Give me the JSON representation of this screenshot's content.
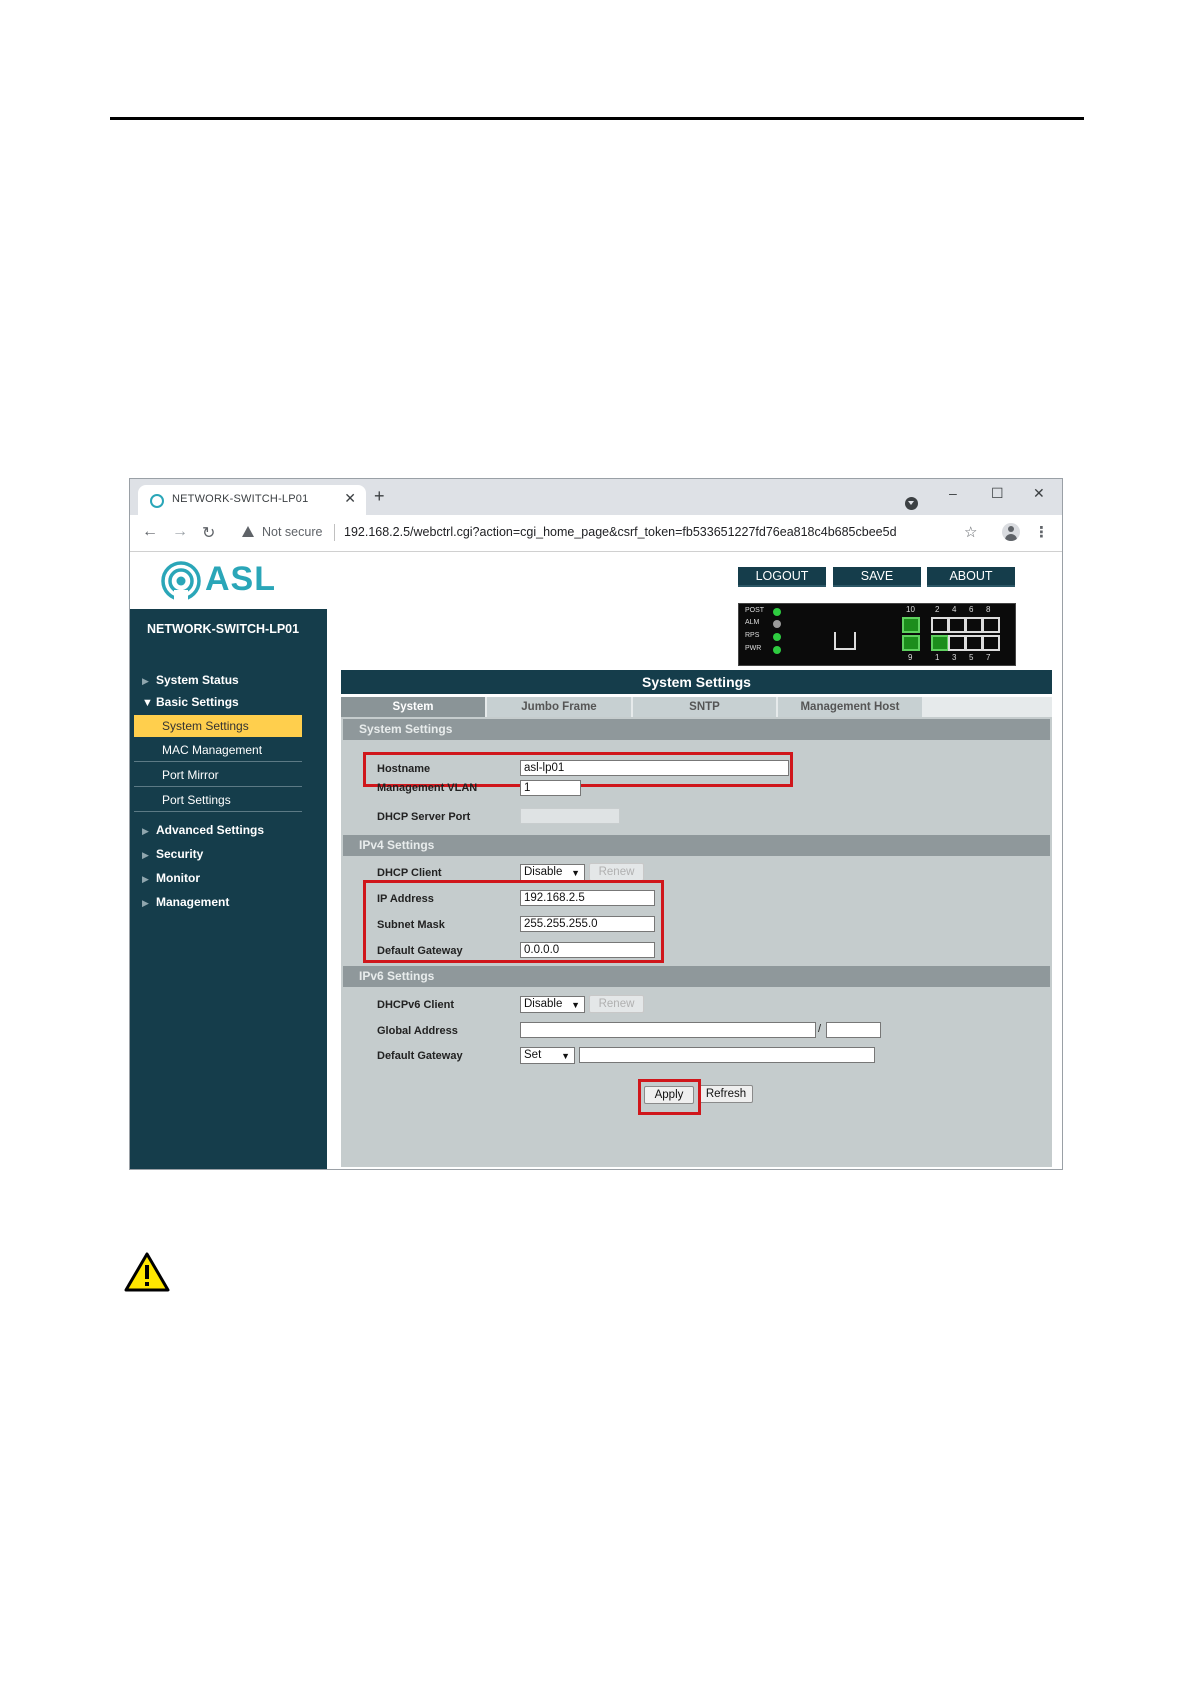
{
  "browser": {
    "tab_title": "NETWORK-SWITCH-LP01",
    "tab_close": "✕",
    "new_tab": "+",
    "not_secure": "Not secure",
    "url": "192.168.2.5/webctrl.cgi?action=cgi_home_page&csrf_token=fb533651227fd76ea818c4b685cbee5d",
    "window_buttons": [
      "–",
      "☐",
      "✕"
    ]
  },
  "brand": {
    "logo_text": "ASL"
  },
  "device_name": "NETWORK-SWITCH-LP01",
  "top_buttons": {
    "logout": "LOGOUT",
    "save": "SAVE",
    "about": "ABOUT"
  },
  "panel": {
    "leds": [
      {
        "label": "POST",
        "color": "#2ecc40"
      },
      {
        "label": "ALM",
        "color": "#9a9a9a"
      },
      {
        "label": "RPS",
        "color": "#2ecc40"
      },
      {
        "label": "PWR",
        "color": "#2ecc40"
      }
    ],
    "top_port_numbers": [
      "10",
      "2",
      "4",
      "6",
      "8"
    ],
    "bottom_port_numbers": [
      "9",
      "1",
      "3",
      "5",
      "7"
    ]
  },
  "sidebar": {
    "items": [
      {
        "label": "System Status",
        "expanded": false
      },
      {
        "label": "Basic Settings",
        "expanded": true
      },
      {
        "label": "Advanced Settings",
        "expanded": false
      },
      {
        "label": "Security",
        "expanded": false
      },
      {
        "label": "Monitor",
        "expanded": false
      },
      {
        "label": "Management",
        "expanded": false
      }
    ],
    "subitems": [
      "System Settings",
      "MAC Management",
      "Port Mirror",
      "Port Settings"
    ],
    "active_subitem": "System Settings"
  },
  "main": {
    "title": "System Settings",
    "tabs": [
      "System",
      "Jumbo Frame",
      "SNTP",
      "Management Host"
    ],
    "active_tab": "System",
    "system_section": {
      "header": "System Settings",
      "hostname_label": "Hostname",
      "hostname_value": "asl-lp01",
      "vlan_label": "Management VLAN",
      "vlan_value": "1",
      "dhcp_server_port_label": "DHCP Server Port",
      "dhcp_server_port_value": ""
    },
    "ipv4_section": {
      "header": "IPv4 Settings",
      "dhcp_client_label": "DHCP Client",
      "dhcp_client_value": "Disable",
      "renew_label": "Renew",
      "ip_label": "IP Address",
      "ip_value": "192.168.2.5",
      "mask_label": "Subnet Mask",
      "mask_value": "255.255.255.0",
      "gateway_label": "Default Gateway",
      "gateway_value": "0.0.0.0"
    },
    "ipv6_section": {
      "header": "IPv6 Settings",
      "dhcpv6_label": "DHCPv6 Client",
      "dhcpv6_value": "Disable",
      "renew_label": "Renew",
      "global_label": "Global Address",
      "global_value": "",
      "prefix_sep": "/",
      "prefix_value": "",
      "gateway_label": "Default Gateway",
      "gateway_mode": "Set",
      "gateway_value": ""
    },
    "apply_label": "Apply",
    "refresh_label": "Refresh"
  },
  "colors": {
    "sidebar_bg": "#153d4b",
    "active_menu": "#ffcf4d",
    "highlight_border": "#d0161b",
    "brand": "#2aa6b8",
    "warning_yellow": "#ffe600"
  }
}
